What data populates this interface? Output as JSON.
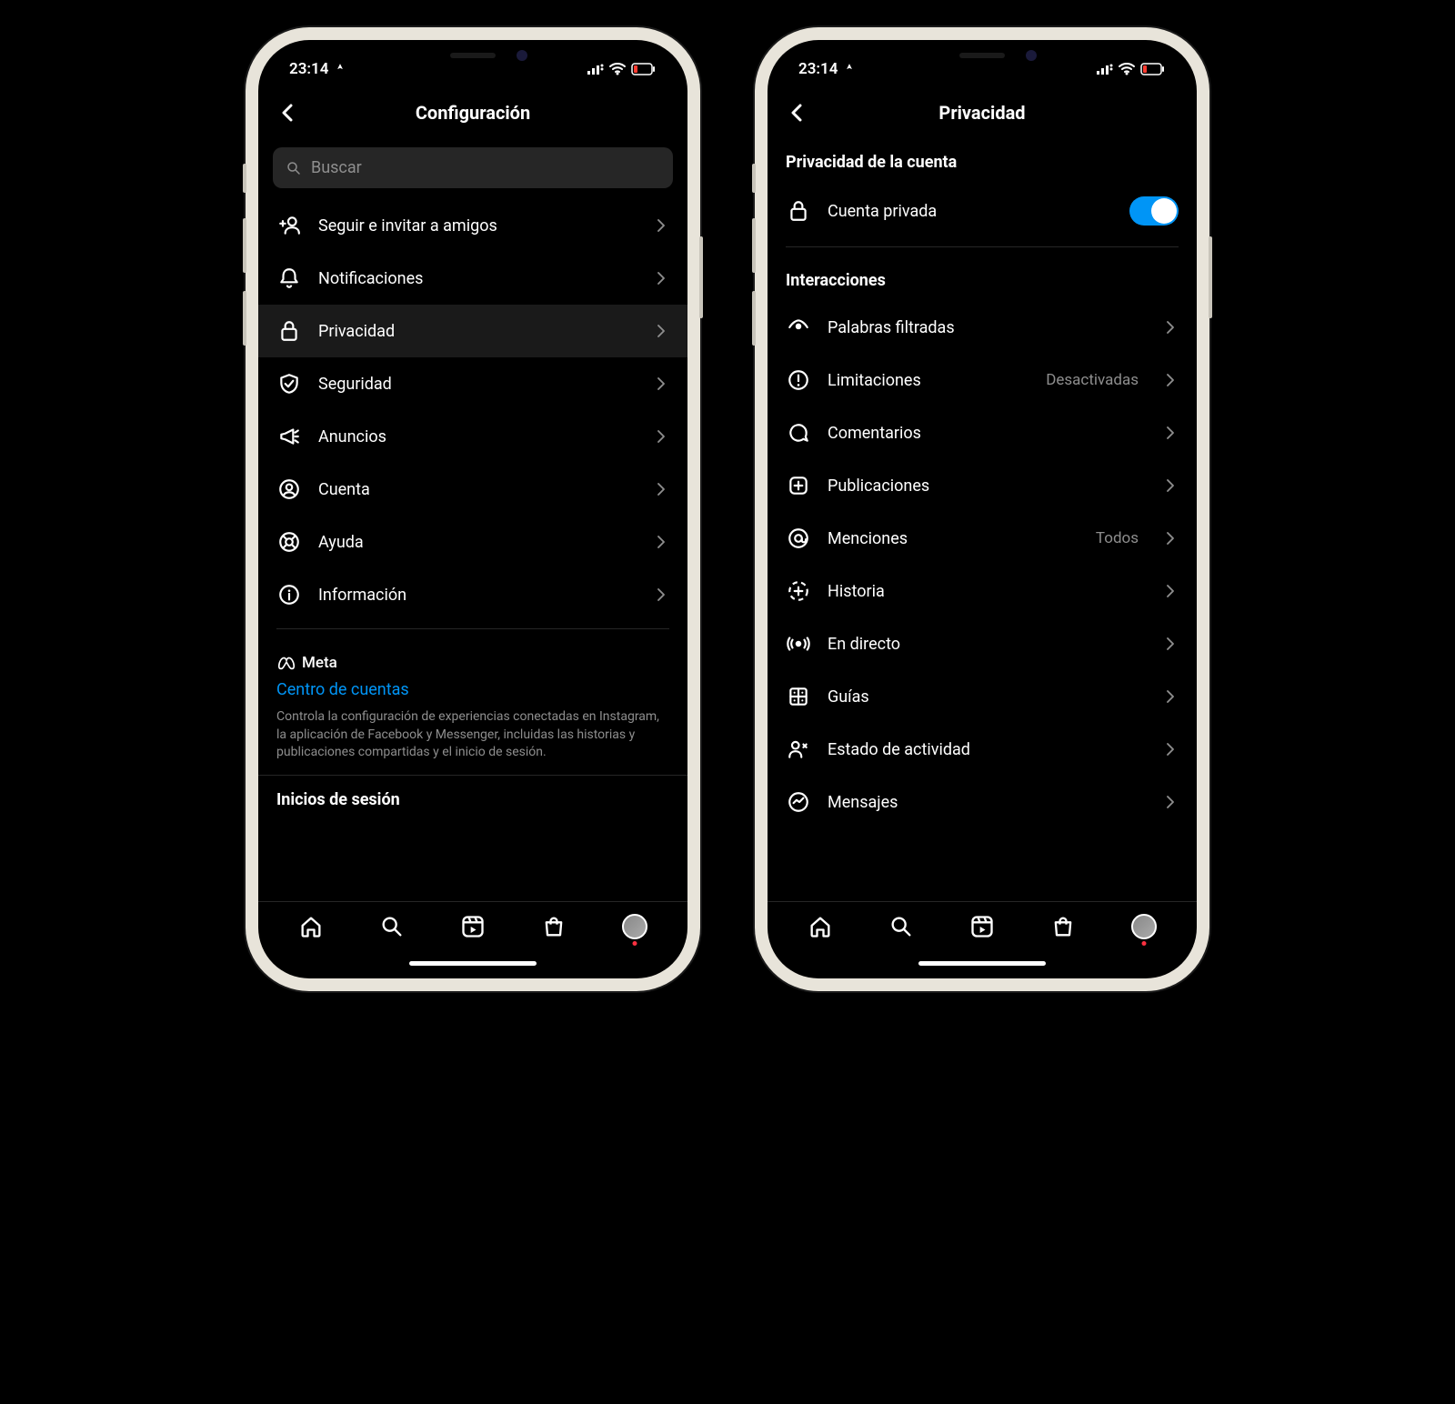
{
  "statusbar": {
    "time": "23:14"
  },
  "phone1": {
    "title": "Configuración",
    "search_placeholder": "Buscar",
    "rows": [
      {
        "label": "Seguir e invitar a amigos"
      },
      {
        "label": "Notificaciones"
      },
      {
        "label": "Privacidad"
      },
      {
        "label": "Seguridad"
      },
      {
        "label": "Anuncios"
      },
      {
        "label": "Cuenta"
      },
      {
        "label": "Ayuda"
      },
      {
        "label": "Información"
      }
    ],
    "meta_brand": "Meta",
    "meta_link": "Centro de cuentas",
    "meta_desc": "Controla la configuración de experiencias conectadas en Instagram, la aplicación de Facebook y Messenger, incluidas las historias y publicaciones compartidas y el inicio de sesión.",
    "logins_header": "Inicios de sesión"
  },
  "phone2": {
    "title": "Privacidad",
    "section1_header": "Privacidad de la cuenta",
    "private_label": "Cuenta privada",
    "section2_header": "Interacciones",
    "rows": [
      {
        "label": "Palabras filtradas",
        "value": ""
      },
      {
        "label": "Limitaciones",
        "value": "Desactivadas"
      },
      {
        "label": "Comentarios",
        "value": ""
      },
      {
        "label": "Publicaciones",
        "value": ""
      },
      {
        "label": "Menciones",
        "value": "Todos"
      },
      {
        "label": "Historia",
        "value": ""
      },
      {
        "label": "En directo",
        "value": ""
      },
      {
        "label": "Guías",
        "value": ""
      },
      {
        "label": "Estado de actividad",
        "value": ""
      },
      {
        "label": "Mensajes",
        "value": ""
      }
    ]
  }
}
